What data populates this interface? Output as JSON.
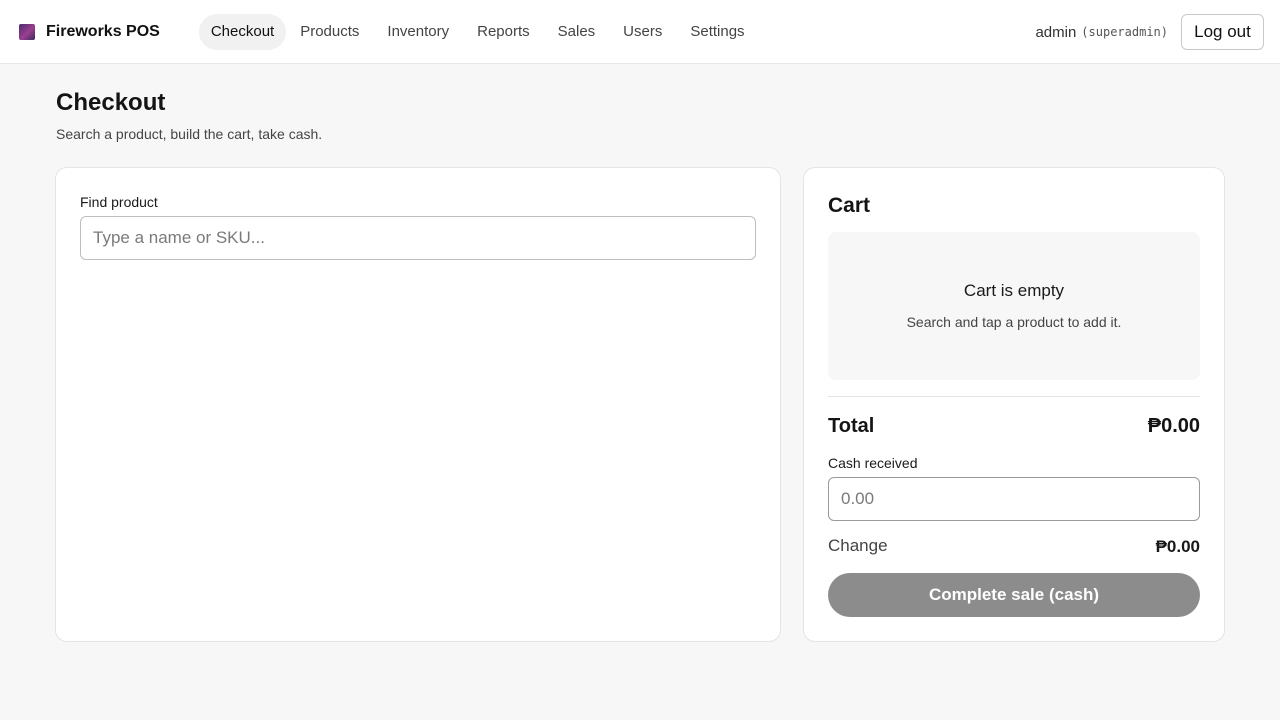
{
  "app": {
    "name": "Fireworks POS",
    "logo_icon": "fireworks-logo-icon"
  },
  "nav": {
    "items": [
      {
        "label": "Checkout",
        "active": true
      },
      {
        "label": "Products",
        "active": false
      },
      {
        "label": "Inventory",
        "active": false
      },
      {
        "label": "Reports",
        "active": false
      },
      {
        "label": "Sales",
        "active": false
      },
      {
        "label": "Users",
        "active": false
      },
      {
        "label": "Settings",
        "active": false
      }
    ]
  },
  "user": {
    "name": "admin",
    "role": "(superadmin)",
    "logout_label": "Log out"
  },
  "page": {
    "title": "Checkout",
    "subtitle": "Search a product, build the cart, take cash."
  },
  "search": {
    "label": "Find product",
    "value": "",
    "placeholder": "Type a name or SKU..."
  },
  "cart": {
    "title": "Cart",
    "empty_title": "Cart is empty",
    "empty_subtitle": "Search and tap a product to add it.",
    "total_label": "Total",
    "total_value": "₱0.00",
    "cash_label": "Cash received",
    "cash_value": "",
    "cash_placeholder": "0.00",
    "change_label": "Change",
    "change_value": "₱0.00",
    "complete_label": "Complete sale (cash)",
    "complete_enabled": false
  },
  "colors": {
    "accent": "#111111",
    "disabled_button": "#8c8c8c",
    "page_background": "#f7f7f7",
    "card_background": "#ffffff"
  }
}
